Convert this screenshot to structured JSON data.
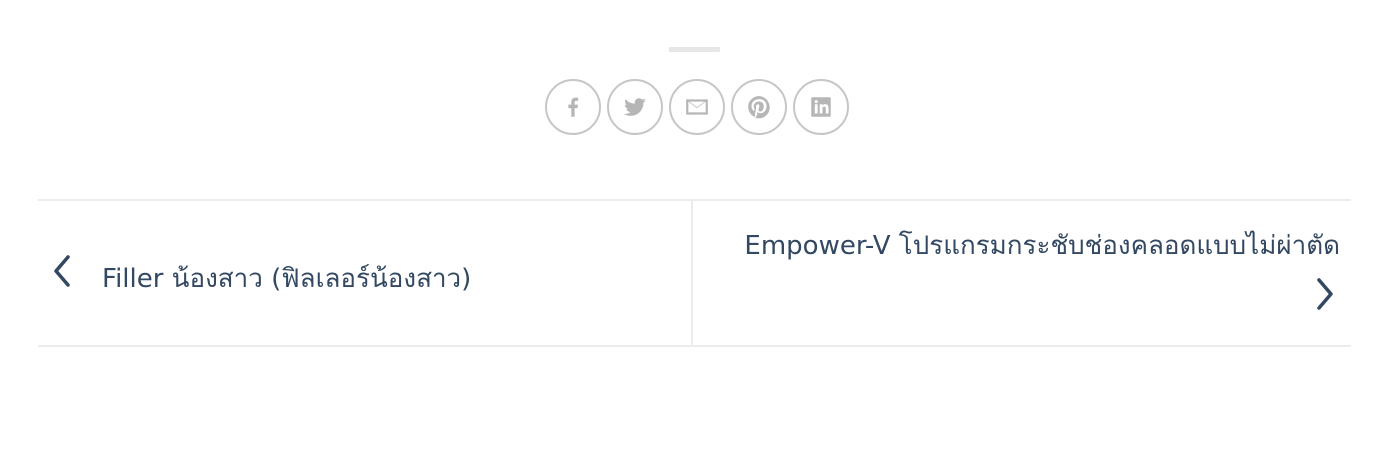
{
  "share": {
    "buttons": [
      {
        "icon": "facebook-icon",
        "name": "Facebook"
      },
      {
        "icon": "twitter-icon",
        "name": "Twitter"
      },
      {
        "icon": "email-icon",
        "name": "Email"
      },
      {
        "icon": "pinterest-icon",
        "name": "Pinterest"
      },
      {
        "icon": "linkedin-icon",
        "name": "LinkedIn"
      }
    ],
    "icon_color": "#b6b6b6",
    "border_color": "#c6c6c6"
  },
  "post_nav": {
    "prev_title": "Filler น้องสาว (ฟิลเลอร์น้องสาว)",
    "next_title": "Empower-V โปรแกรมกระชับช่องคลอดแบบไม่ผ่าตัด",
    "text_color": "#334862",
    "border_color": "#ececec"
  }
}
